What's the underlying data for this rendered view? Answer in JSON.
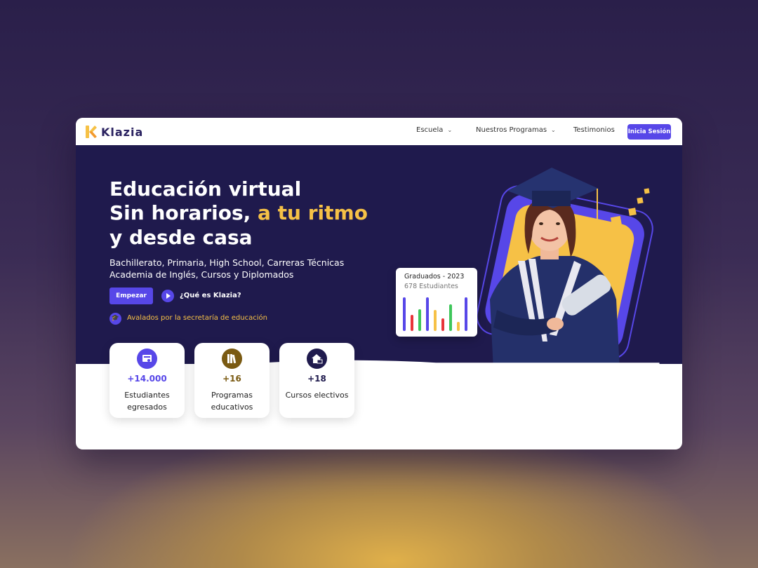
{
  "nav": {
    "logo_text": "Klazia",
    "items": [
      {
        "label": "Escuela",
        "has_dropdown": true
      },
      {
        "label": "Nuestros Programas",
        "has_dropdown": true
      },
      {
        "label": "Testimonios",
        "has_dropdown": false
      }
    ],
    "login_label": "Inicia Sesión"
  },
  "hero": {
    "headline_line1": "Educación virtual",
    "headline_line2_part1": "Sin horarios, ",
    "headline_line2_accent": "a tu ritmo",
    "headline_line3": "y desde casa",
    "subtitle_line1": "Bachillerato, Primaria, High School, Carreras Técnicas",
    "subtitle_line2": "Academia de Inglés, Cursos y Diplomados",
    "start_label": "Empezar",
    "video_label": "¿Qué es Klazia?",
    "endorsement": "Avalados por la secretaría de educación"
  },
  "stats": [
    {
      "value": "+14.000",
      "label_line1": "Estudiantes",
      "label_line2": "egresados",
      "icon": "certificate-icon",
      "color": "#5747e8"
    },
    {
      "value": "+16",
      "label_line1": "Programas",
      "label_line2": "educativos",
      "icon": "books-icon",
      "color": "#7a5a12"
    },
    {
      "value": "+18",
      "label_line1": "Cursos electivos",
      "label_line2": "",
      "icon": "house-laptop-icon",
      "color": "#1f1a4d"
    }
  ],
  "graduates_card": {
    "title": "Graduados - 2023",
    "count": "678 Estudiantes",
    "bars": [
      {
        "value": 0.95,
        "color": "#5747e8"
      },
      {
        "value": 0.45,
        "color": "#e8343a"
      },
      {
        "value": 0.62,
        "color": "#3ec65a"
      },
      {
        "value": 0.95,
        "color": "#5747e8"
      },
      {
        "value": 0.6,
        "color": "#f6c146"
      },
      {
        "value": 0.35,
        "color": "#e8343a"
      },
      {
        "value": 0.75,
        "color": "#3ec65a"
      },
      {
        "value": 0.25,
        "color": "#f6c146"
      },
      {
        "value": 0.95,
        "color": "#5747e8"
      }
    ]
  },
  "colors": {
    "primary": "#5747e8",
    "accent": "#f6c146",
    "hero_bg": "#1f1a4d"
  }
}
